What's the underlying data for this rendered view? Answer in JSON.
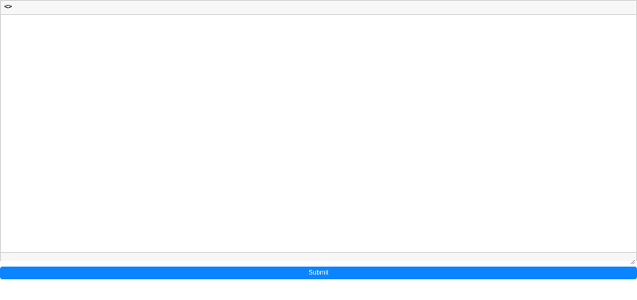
{
  "editor": {
    "toolbar": {
      "code_toggle_label": "<>"
    },
    "content_text": "",
    "resize_icon": "resize-grip-icon"
  },
  "form": {
    "submit_label": "Submit",
    "submit_color": "#0a84ff"
  }
}
